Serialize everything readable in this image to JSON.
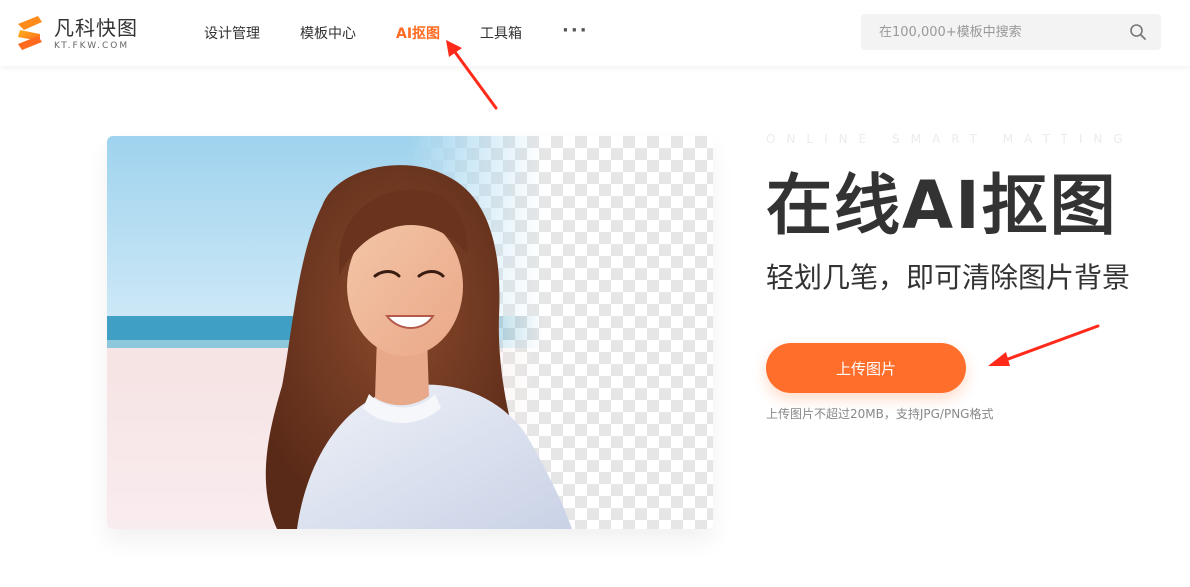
{
  "header": {
    "logo_name": "凡科快图",
    "logo_domain": "KT.FKW.COM",
    "nav": [
      {
        "label": "设计管理",
        "active": false
      },
      {
        "label": "模板中心",
        "active": false
      },
      {
        "label": "AI抠图",
        "active": true
      },
      {
        "label": "工具箱",
        "active": false
      }
    ],
    "more_label": "···",
    "search": {
      "placeholder": "在100,000+模板中搜索",
      "value": ""
    }
  },
  "hero": {
    "eyebrow": "ONLINE SMART MATTING",
    "title": "在线AI抠图",
    "subtitle": "轻划几笔，即可清除图片背景",
    "upload_label": "上传图片",
    "hint": "上传图片不超过20MB，支持JPG/PNG格式"
  },
  "colors": {
    "accent": "#ff6e2a",
    "active_nav": "#ff6b22",
    "annotation_arrow": "#ff2a1a"
  },
  "icons": {
    "logo": "logo-s-icon",
    "search": "search-icon",
    "more": "more-dots-icon"
  }
}
